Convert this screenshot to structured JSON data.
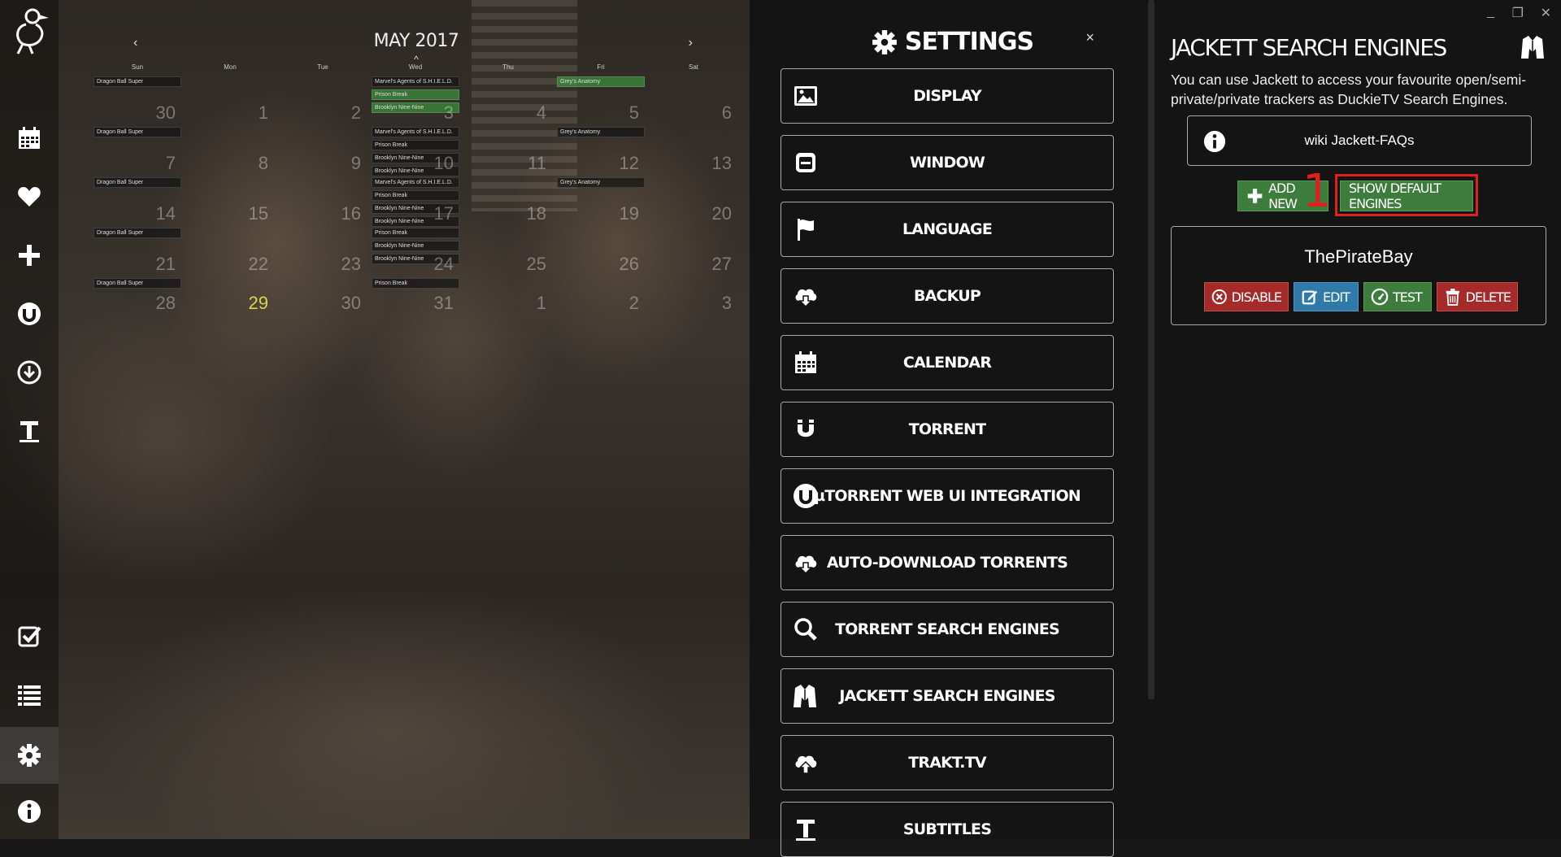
{
  "sidebar": {
    "items": [
      {
        "name": "calendar",
        "icon": "calendar-icon"
      },
      {
        "name": "favorites",
        "icon": "heart-icon"
      },
      {
        "name": "add",
        "icon": "plus-icon"
      },
      {
        "name": "utorrent",
        "icon": "utorrent-icon"
      },
      {
        "name": "downloads",
        "icon": "download-icon"
      },
      {
        "name": "subtitles",
        "icon": "text-icon"
      },
      {
        "name": "watchlist",
        "icon": "checkbox-icon"
      },
      {
        "name": "list",
        "icon": "list-icon"
      },
      {
        "name": "settings",
        "icon": "gear-icon"
      },
      {
        "name": "about",
        "icon": "info-icon"
      }
    ]
  },
  "calendar": {
    "title": "MAY 2017",
    "prev": "‹",
    "next": "›",
    "up": "^",
    "days": [
      "Sun",
      "Mon",
      "Tue",
      "Wed",
      "Thu",
      "Fri",
      "Sat"
    ],
    "weeks": [
      [
        {
          "num": "30",
          "events": [
            {
              "t": "Dragon Ball Super"
            }
          ]
        },
        {
          "num": "1",
          "events": []
        },
        {
          "num": "2",
          "events": []
        },
        {
          "num": "3",
          "events": [
            {
              "t": "Marvel's Agents of S.H.I.E.L.D."
            },
            {
              "t": "Prison Break",
              "g": true
            },
            {
              "t": "Brooklyn Nine-Nine",
              "g": true
            }
          ]
        },
        {
          "num": "4",
          "events": []
        },
        {
          "num": "5",
          "events": [
            {
              "t": "Grey's Anatomy",
              "g": true
            }
          ]
        },
        {
          "num": "6",
          "events": []
        }
      ],
      [
        {
          "num": "7",
          "events": [
            {
              "t": "Dragon Ball Super"
            }
          ]
        },
        {
          "num": "8",
          "events": []
        },
        {
          "num": "9",
          "events": []
        },
        {
          "num": "10",
          "events": [
            {
              "t": "Marvel's Agents of S.H.I.E.L.D."
            },
            {
              "t": "Prison Break"
            },
            {
              "t": "Brooklyn Nine-Nine"
            },
            {
              "t": "Brooklyn Nine-Nine"
            }
          ]
        },
        {
          "num": "11",
          "events": []
        },
        {
          "num": "12",
          "events": [
            {
              "t": "Grey's Anatomy"
            }
          ]
        },
        {
          "num": "13",
          "events": []
        }
      ],
      [
        {
          "num": "14",
          "events": [
            {
              "t": "Dragon Ball Super"
            }
          ]
        },
        {
          "num": "15",
          "events": []
        },
        {
          "num": "16",
          "events": []
        },
        {
          "num": "17",
          "events": [
            {
              "t": "Marvel's Agents of S.H.I.E.L.D."
            },
            {
              "t": "Prison Break"
            },
            {
              "t": "Brooklyn Nine-Nine"
            },
            {
              "t": "Brooklyn Nine-Nine"
            }
          ]
        },
        {
          "num": "18",
          "events": []
        },
        {
          "num": "19",
          "events": [
            {
              "t": "Grey's Anatomy"
            }
          ]
        },
        {
          "num": "20",
          "events": []
        }
      ],
      [
        {
          "num": "21",
          "events": [
            {
              "t": "Dragon Ball Super"
            }
          ]
        },
        {
          "num": "22",
          "events": []
        },
        {
          "num": "23",
          "events": []
        },
        {
          "num": "24",
          "events": [
            {
              "t": "Prison Break"
            },
            {
              "t": "Brooklyn Nine-Nine"
            },
            {
              "t": "Brooklyn Nine-Nine"
            }
          ]
        },
        {
          "num": "25",
          "events": []
        },
        {
          "num": "26",
          "events": []
        },
        {
          "num": "27",
          "events": []
        }
      ],
      [
        {
          "num": "28",
          "events": [
            {
              "t": "Dragon Ball Super"
            }
          ]
        },
        {
          "num": "29",
          "events": [],
          "today": true
        },
        {
          "num": "30",
          "events": []
        },
        {
          "num": "31",
          "events": [
            {
              "t": "Prison Break"
            }
          ]
        },
        {
          "num": "1",
          "events": []
        },
        {
          "num": "2",
          "events": []
        },
        {
          "num": "3",
          "events": []
        }
      ]
    ]
  },
  "settings": {
    "title": "SETTINGS",
    "close": "×",
    "menu": [
      {
        "label": "DISPLAY",
        "icon": "image-icon"
      },
      {
        "label": "WINDOW",
        "icon": "window-icon"
      },
      {
        "label": "LANGUAGE",
        "icon": "flag-icon"
      },
      {
        "label": "BACKUP",
        "icon": "cloud-download-icon"
      },
      {
        "label": "CALENDAR",
        "icon": "calendar-icon"
      },
      {
        "label": "TORRENT",
        "icon": "magnet-icon"
      },
      {
        "label": "µTORRENT WEB UI INTEGRATION",
        "icon": "utorrent-icon"
      },
      {
        "label": "AUTO-DOWNLOAD TORRENTS",
        "icon": "cloud-download-icon"
      },
      {
        "label": "TORRENT SEARCH ENGINES",
        "icon": "search-icon"
      },
      {
        "label": "JACKETT SEARCH ENGINES",
        "icon": "jacket-icon"
      },
      {
        "label": "TRAKT.TV",
        "icon": "cloud-upload-icon"
      },
      {
        "label": "SUBTITLES",
        "icon": "text-icon"
      }
    ]
  },
  "jackett": {
    "title": "JACKETT SEARCH ENGINES",
    "description": "You can use Jackett to access your favourite open/semi-private/private trackers as DuckieTV Search Engines.",
    "wiki_label": "wiki Jackett-FAQs",
    "add_new_label": "ADD NEW",
    "show_default_label": "SHOW DEFAULT ENGINES",
    "annotation": "1",
    "engines": [
      {
        "name": "ThePirateBay",
        "disable_label": "DISABLE",
        "edit_label": "EDIT",
        "test_label": "TEST",
        "delete_label": "DELETE"
      }
    ]
  },
  "window_controls": {
    "minimize": "_",
    "restore": "❐",
    "close": "✕"
  },
  "colors": {
    "green": "#3d7c3d",
    "blue": "#2f7aa8",
    "red": "#a52a2a",
    "highlight": "#e02020",
    "today": "#d8d84a"
  }
}
